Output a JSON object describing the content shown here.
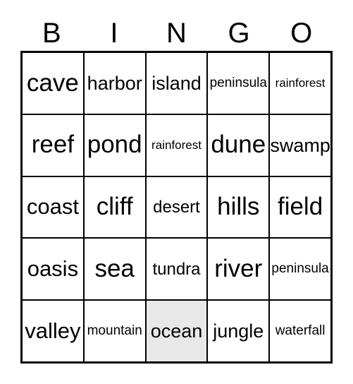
{
  "card": {
    "title": "BINGO",
    "header_letters": [
      "B",
      "I",
      "N",
      "G",
      "O"
    ],
    "colors": {
      "background": "#ffffff",
      "grid_line": "#000000",
      "text": "#000000",
      "marked_cell": "#e8e8e8"
    },
    "rows": [
      [
        {
          "label": "cave",
          "marked": false,
          "size": "xl"
        },
        {
          "label": "harbor",
          "marked": false,
          "size": "md"
        },
        {
          "label": "island",
          "marked": false,
          "size": "md"
        },
        {
          "label": "peninsula",
          "marked": false,
          "size": "xs"
        },
        {
          "label": "rainforest",
          "marked": false,
          "size": "xxs"
        }
      ],
      [
        {
          "label": "reef",
          "marked": false,
          "size": "xl"
        },
        {
          "label": "pond",
          "marked": false,
          "size": "xl"
        },
        {
          "label": "rainforest",
          "marked": false,
          "size": "xxs"
        },
        {
          "label": "dune",
          "marked": false,
          "size": "xl"
        },
        {
          "label": "swamp",
          "marked": false,
          "size": "md"
        }
      ],
      [
        {
          "label": "coast",
          "marked": false,
          "size": "lg"
        },
        {
          "label": "cliff",
          "marked": false,
          "size": "xl"
        },
        {
          "label": "desert",
          "marked": false,
          "size": "sm"
        },
        {
          "label": "hills",
          "marked": false,
          "size": "xl"
        },
        {
          "label": "field",
          "marked": false,
          "size": "xl"
        }
      ],
      [
        {
          "label": "oasis",
          "marked": false,
          "size": "lg"
        },
        {
          "label": "sea",
          "marked": false,
          "size": "xl"
        },
        {
          "label": "tundra",
          "marked": false,
          "size": "sm"
        },
        {
          "label": "river",
          "marked": false,
          "size": "xl"
        },
        {
          "label": "peninsula",
          "marked": false,
          "size": "xs"
        }
      ],
      [
        {
          "label": "valley",
          "marked": false,
          "size": "lg"
        },
        {
          "label": "mountain",
          "marked": false,
          "size": "xs"
        },
        {
          "label": "ocean",
          "marked": true,
          "size": "md"
        },
        {
          "label": "jungle",
          "marked": false,
          "size": "md"
        },
        {
          "label": "waterfall",
          "marked": false,
          "size": "xs"
        }
      ]
    ]
  }
}
